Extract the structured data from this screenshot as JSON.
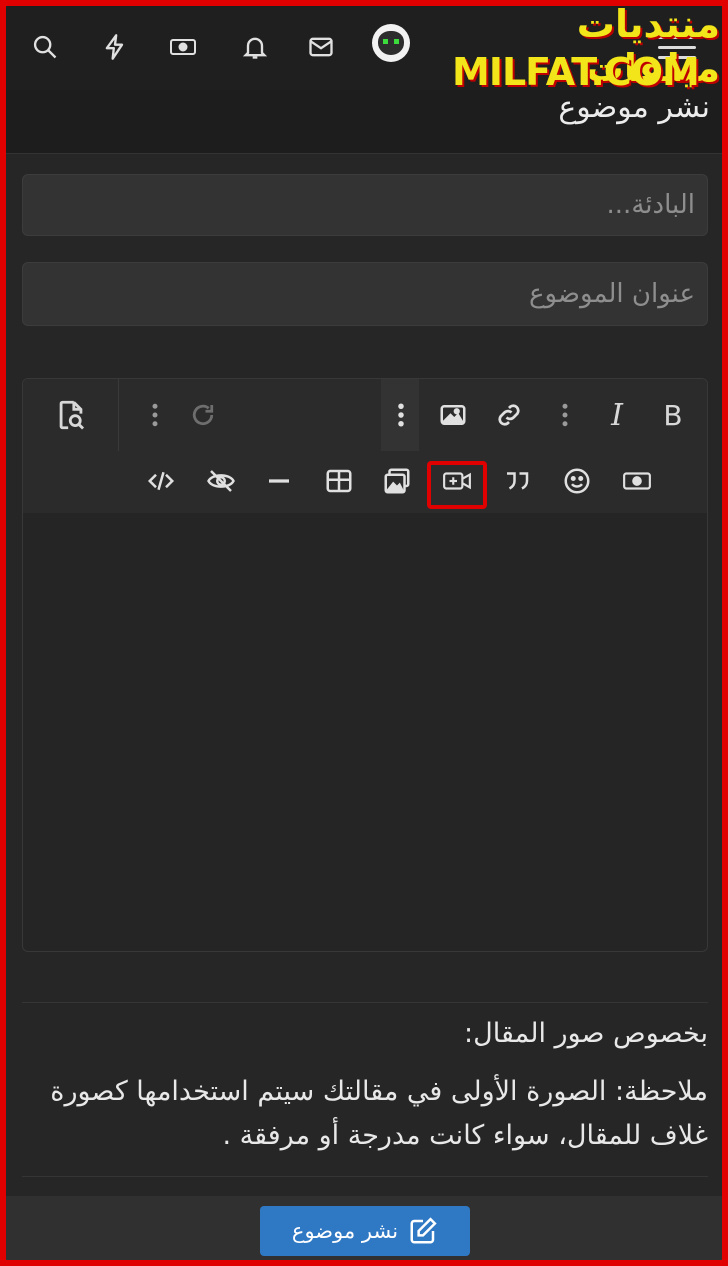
{
  "logo": {
    "line1": "منتديات ميلفات",
    "line2": "MILFAT.COM"
  },
  "navbar": {
    "icons": [
      "search-icon",
      "lightning-icon",
      "money-icon",
      "bell-icon",
      "mail-icon",
      "avatar",
      "menu-icon"
    ]
  },
  "page": {
    "title": "نشر موضوع"
  },
  "form": {
    "prefix_placeholder": "البادئة...",
    "title_placeholder": "عنوان الموضوع"
  },
  "editor": {
    "toolbar_row1": [
      "bold-icon",
      "italic-icon",
      "more-dots-icon",
      "link-icon",
      "image-icon",
      "more-vertical-icon",
      "redo-icon",
      "more-dots-icon",
      "preview-icon"
    ],
    "toolbar_row2": [
      "money-icon",
      "smile-icon",
      "quote-icon",
      "media-icon",
      "gallery-icon",
      "table-icon",
      "hr-icon",
      "hide-icon",
      "code-icon"
    ],
    "bold_label": "B",
    "italic_label": "I",
    "highlighted_button": "media-icon",
    "highlight_color": "#e00000"
  },
  "note": {
    "heading": "بخصوص صور المقال:",
    "body": "ملاحظة: الصورة الأولى في مقالتك سيتم استخدامها كصورة غلاف للمقال، سواء كانت مدرجة أو مرفقة ."
  },
  "footer": {
    "submit_label": "نشر موضوع"
  },
  "colors": {
    "accent": "#2f78c4",
    "frame": "#e00000",
    "background": "#262626"
  }
}
